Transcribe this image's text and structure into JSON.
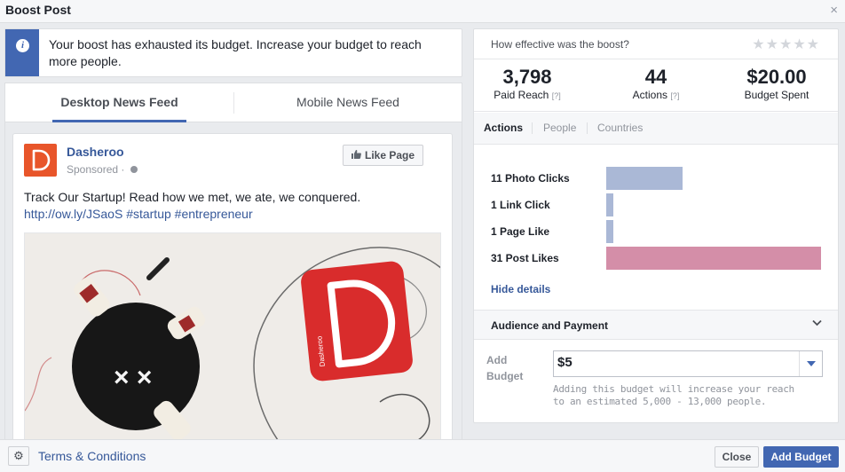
{
  "dialog": {
    "title": "Boost Post",
    "close_glyph": "×"
  },
  "alert": {
    "icon": "info-icon",
    "message": "Your boost has exhausted its budget. Increase your budget to reach more people."
  },
  "preview_tabs": [
    {
      "label": "Desktop News Feed",
      "active": true
    },
    {
      "label": "Mobile News Feed",
      "active": false
    }
  ],
  "post": {
    "page_name": "Dasheroo",
    "sponsored": "Sponsored",
    "separator": "·",
    "like_button": "Like Page",
    "text": "Track Our Startup! Read how we met, we ate, we conquered.",
    "link": "http://ow.ly/JSaoS",
    "hashtags": [
      "#startup",
      "#entrepreneur"
    ],
    "image_text": "Dasheroo",
    "brand_color": "#e8552a"
  },
  "effectiveness": {
    "question": "How effective was the boost?",
    "stars_total": 5,
    "stars_filled": 0
  },
  "stats": [
    {
      "value": "3,798",
      "label": "Paid Reach",
      "help": "[?]"
    },
    {
      "value": "44",
      "label": "Actions",
      "help": "[?]"
    },
    {
      "value": "$20.00",
      "label": "Budget Spent",
      "help": ""
    }
  ],
  "detail_tabs": [
    {
      "label": "Actions",
      "active": true
    },
    {
      "label": "People",
      "active": false
    },
    {
      "label": "Countries",
      "active": false
    }
  ],
  "actions": [
    {
      "label": "11 Photo Clicks",
      "count": 11,
      "color": "#aab8d6"
    },
    {
      "label": "1 Link Click",
      "count": 1,
      "color": "#aab8d6"
    },
    {
      "label": "1 Page Like",
      "count": 1,
      "color": "#aab8d6"
    },
    {
      "label": "31 Post Likes",
      "count": 31,
      "color": "#d48ea8"
    }
  ],
  "hide_details": "Hide details",
  "audience": {
    "title": "Audience and Payment"
  },
  "budget": {
    "label": "Add Budget",
    "value": "$5",
    "note": "Adding this budget will increase your reach to an estimated 5,000 - 13,000 people."
  },
  "footer": {
    "terms": "Terms & Conditions",
    "close": "Close",
    "add_budget": "Add Budget"
  },
  "colors": {
    "accent": "#4267b2",
    "link": "#365899"
  }
}
